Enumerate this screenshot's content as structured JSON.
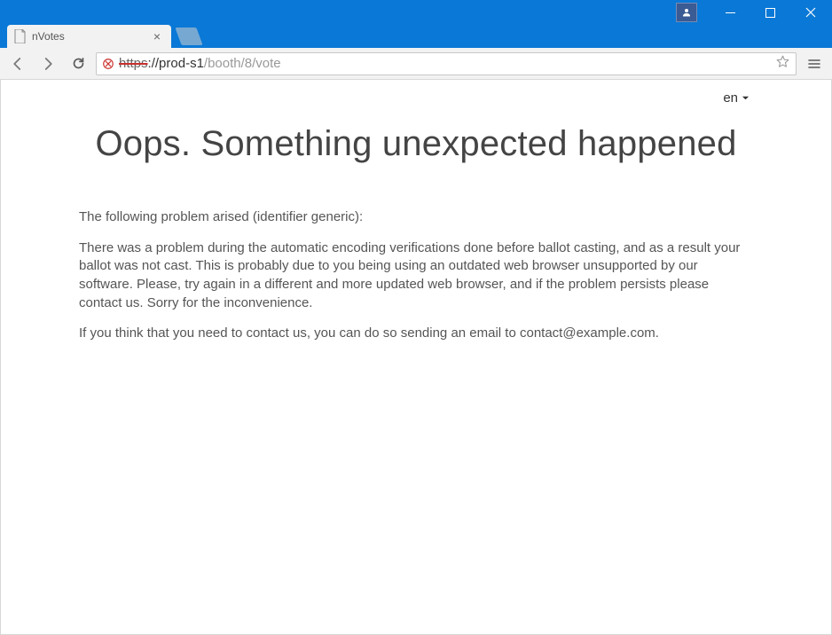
{
  "window": {
    "tab_title": "nVotes"
  },
  "address": {
    "protocol": "https",
    "sep": "://",
    "host": "prod-s1",
    "path": "/booth/8/vote"
  },
  "page": {
    "lang_label": "en",
    "heading": "Oops. Something unexpected happened",
    "intro": "The following problem arised (identifier generic):",
    "body": "There was a problem during the automatic encoding verifications done before ballot casting, and as a result your ballot was not cast. This is probably due to you being using an outdated web browser unsupported by our software. Please, try again in a different and more updated web browser, and if the problem persists please contact us. Sorry for the inconvenience.",
    "contact": "If you think that you need to contact us, you can do so sending an email to contact@example.com."
  }
}
